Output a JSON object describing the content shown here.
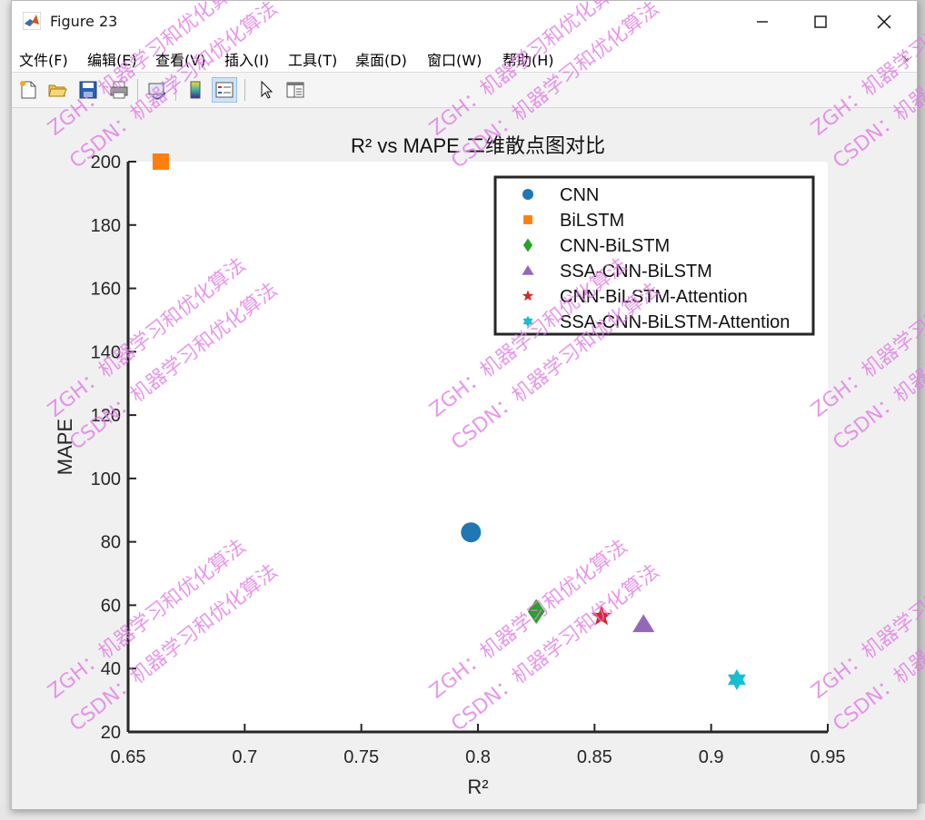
{
  "window": {
    "title": "Figure 23"
  },
  "menu": [
    "文件(F)",
    "编辑(E)",
    "查看(V)",
    "插入(I)",
    "工具(T)",
    "桌面(D)",
    "窗口(W)",
    "帮助(H)"
  ],
  "toolbar": [
    "new-figure",
    "open-file",
    "save",
    "print",
    "link-plot",
    "colorbar",
    "legend",
    "pointer",
    "property-editor"
  ],
  "watermark": {
    "lines": [
      "ZGH：机器学习和优化算法",
      "CSDN：机器学习和优化算法"
    ],
    "color": "#e27ae6"
  },
  "chart_data": {
    "type": "scatter",
    "title": "R² vs MAPE 二维散点图对比",
    "xlabel": "R²",
    "ylabel": "MAPE",
    "xlim": [
      0.65,
      0.95
    ],
    "ylim": [
      20,
      200
    ],
    "xticks": [
      "0.65",
      "0.7",
      "0.75",
      "0.8",
      "0.85",
      "0.9",
      "0.95"
    ],
    "yticks": [
      "20",
      "40",
      "60",
      "80",
      "100",
      "120",
      "140",
      "160",
      "180",
      "200"
    ],
    "legend_position": "top-right",
    "grid": false,
    "series": [
      {
        "name": "CNN",
        "marker": "circle",
        "color": "#1f77b4",
        "x": 0.797,
        "y": 83
      },
      {
        "name": "BiLSTM",
        "marker": "square",
        "color": "#ff7f0e",
        "x": 0.664,
        "y": 200
      },
      {
        "name": "CNN-BiLSTM",
        "marker": "diamond",
        "color": "#2ca02c",
        "x": 0.825,
        "y": 58
      },
      {
        "name": "SSA-CNN-BiLSTM",
        "marker": "triangle",
        "color": "#9467bd",
        "x": 0.871,
        "y": 54
      },
      {
        "name": "CNN-BiLSTM-Attention",
        "marker": "star5",
        "color": "#d62728",
        "x": 0.853,
        "y": 56.5
      },
      {
        "name": "SSA-CNN-BiLSTM-Attention",
        "marker": "star6",
        "color": "#17becf",
        "x": 0.911,
        "y": 36.5
      }
    ]
  }
}
